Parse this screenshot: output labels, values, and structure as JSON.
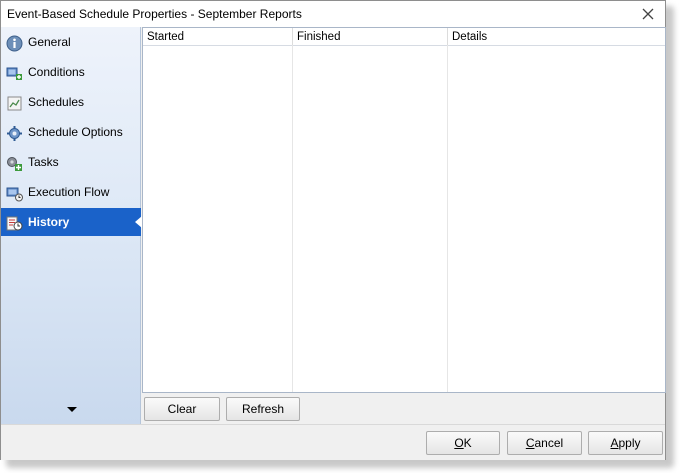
{
  "window": {
    "title": "Event-Based Schedule Properties - September Reports"
  },
  "nav": {
    "items": [
      {
        "label": "General",
        "icon": "info-icon"
      },
      {
        "label": "Conditions",
        "icon": "conditions-icon"
      },
      {
        "label": "Schedules",
        "icon": "schedules-icon"
      },
      {
        "label": "Schedule Options",
        "icon": "schedule-options-icon"
      },
      {
        "label": "Tasks",
        "icon": "tasks-icon"
      },
      {
        "label": "Execution Flow",
        "icon": "execution-flow-icon"
      },
      {
        "label": "History",
        "icon": "history-icon",
        "active": true
      }
    ]
  },
  "history": {
    "columns": [
      "Started",
      "Finished",
      "Details"
    ],
    "rows": [],
    "clear_label": "Clear",
    "refresh_label": "Refresh"
  },
  "dialog_buttons": {
    "ok": {
      "mnemonic": "O",
      "rest": "K"
    },
    "cancel": {
      "mnemonic": "C",
      "rest": "ancel"
    },
    "apply": {
      "mnemonic": "A",
      "rest": "pply"
    }
  },
  "colors": {
    "active_nav": "#1a62c9",
    "nav_gradient_top": "#eef3fb",
    "nav_gradient_bottom": "#c9d9ee"
  }
}
